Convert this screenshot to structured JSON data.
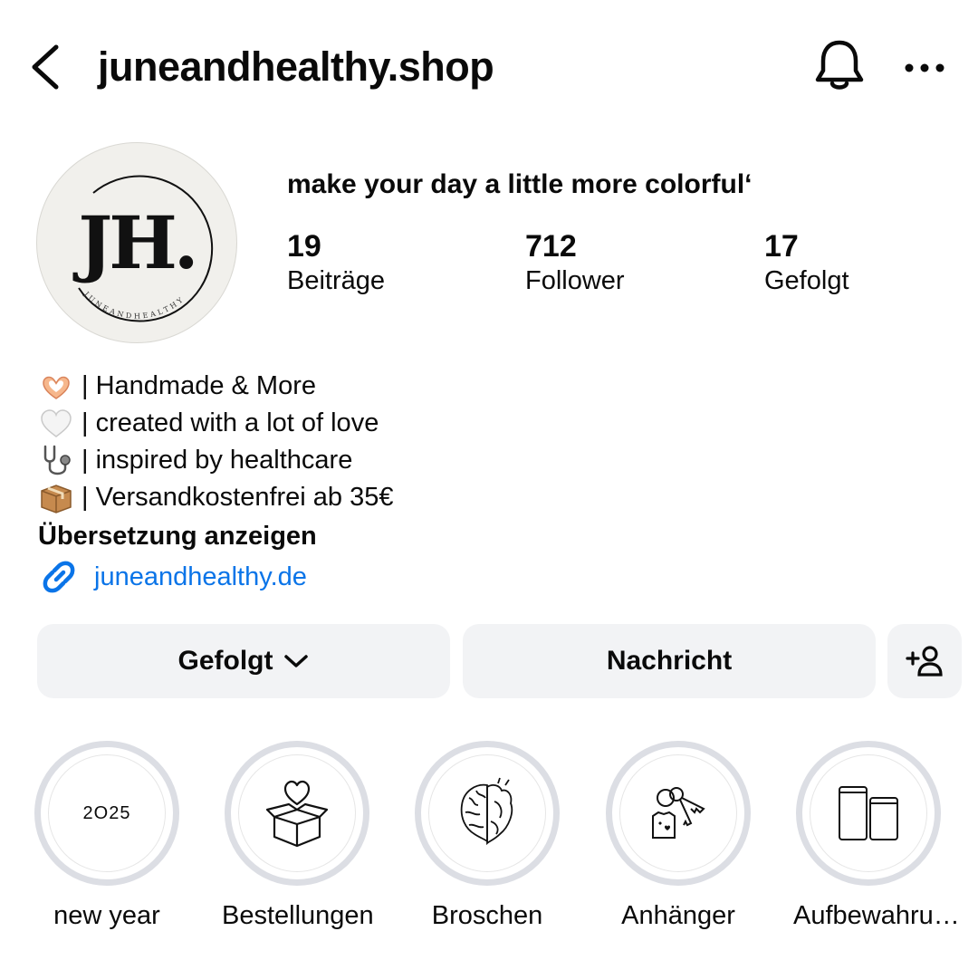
{
  "header": {
    "username": "juneandhealthy.shop"
  },
  "profile": {
    "avatar_text": "JH.",
    "avatar_ring_text": "JUNEANDHEALTHY",
    "display_name": "make your day a little more colorful‘",
    "stats": [
      {
        "value": "19",
        "label": "Beiträge"
      },
      {
        "value": "712",
        "label": "Follower"
      },
      {
        "value": "17",
        "label": "Gefolgt"
      }
    ]
  },
  "bio": {
    "lines": [
      {
        "icon": "heart-hands-icon",
        "text": "| Handmade & More"
      },
      {
        "icon": "white-heart-icon",
        "text": "| created with a lot of love"
      },
      {
        "icon": "stethoscope-icon",
        "text": "| inspired by healthcare"
      },
      {
        "icon": "package-icon",
        "text": "| Versandkostenfrei ab 35€"
      }
    ],
    "translate_label": "Übersetzung anzeigen",
    "link": "juneandhealthy.de"
  },
  "actions": {
    "follow_label": "Gefolgt",
    "message_label": "Nachricht"
  },
  "highlights": [
    {
      "label": "new year",
      "cover_text": "2O25",
      "icon": "text"
    },
    {
      "label": "Bestellungen",
      "icon": "heart-box-icon"
    },
    {
      "label": "Broschen",
      "icon": "brain-heart-icon"
    },
    {
      "label": "Anhänger",
      "icon": "keys-icon"
    },
    {
      "label": "Aufbewahru…",
      "icon": "jars-icon"
    }
  ],
  "colors": {
    "link": "#0a74e8",
    "button_bg": "#f2f3f5",
    "highlight_ring": "#dcdee4"
  }
}
